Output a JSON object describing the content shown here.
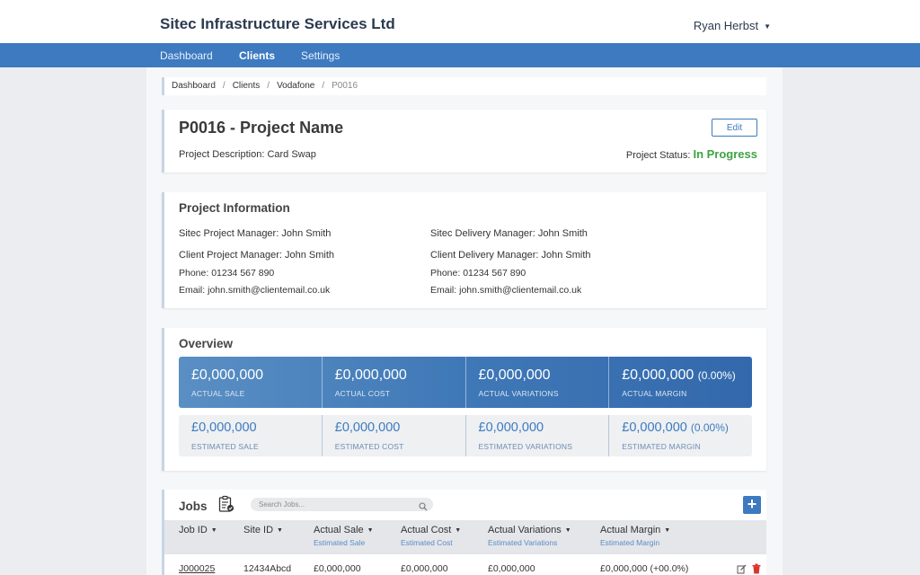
{
  "app": {
    "company_name": "Sitec Infrastructure Services Ltd",
    "user_name": "Ryan Herbst",
    "accent_color": "#3d7abf"
  },
  "nav": {
    "dashboard": "Dashboard",
    "clients": "Clients",
    "settings": "Settings"
  },
  "breadcrumb": [
    "Dashboard",
    "Clients",
    "Vodafone",
    "P0016"
  ],
  "project": {
    "title": "P0016 - Project Name",
    "edit_label": "Edit",
    "description_label": "Project Description:",
    "description_value": "Card Swap",
    "status_label": "Project Status:",
    "status_value": "In Progress",
    "status_color": "#3ea343"
  },
  "info": {
    "heading": "Project Information",
    "sitec_pm_label": "Sitec Project Manager:",
    "sitec_pm_value": "John Smith",
    "sitec_dm_label": "Sitec Delivery Manager:",
    "sitec_dm_value": "John Smith",
    "client_pm_label": "Client Project Manager:",
    "client_pm_value": "John Smith",
    "client_dm_label": "Client Delivery Manager:",
    "client_dm_value": "John Smith",
    "phone_label": "Phone:",
    "phone_left": "01234 567 890",
    "phone_right": "01234 567 890",
    "email_label": "Email:",
    "email_left": "john.smith@clientemail.co.uk",
    "email_right": "john.smith@clientemail.co.uk"
  },
  "overview": {
    "heading": "Overview",
    "actual": [
      {
        "value": "£0,000,000",
        "pct": "",
        "label": "Actual Sale"
      },
      {
        "value": "£0,000,000",
        "pct": "",
        "label": "Actual Cost"
      },
      {
        "value": "£0,000,000",
        "pct": "",
        "label": "Actual Variations"
      },
      {
        "value": "£0,000,000",
        "pct": "(0.00%)",
        "label": "Actual Margin"
      }
    ],
    "estimated": [
      {
        "value": "£0,000,000",
        "pct": "",
        "label": "Estimated Sale"
      },
      {
        "value": "£0,000,000",
        "pct": "",
        "label": "Estimated Cost"
      },
      {
        "value": "£0,000,000",
        "pct": "",
        "label": "Estimated Variations"
      },
      {
        "value": "£0,000,000",
        "pct": "(0.00%)",
        "label": "Estimated Margin"
      }
    ]
  },
  "jobs": {
    "heading": "Jobs",
    "search_placeholder": "Search Jobs...",
    "add_label": "+",
    "columns": [
      {
        "label": "Job ID",
        "sub": ""
      },
      {
        "label": "Site ID",
        "sub": ""
      },
      {
        "label": "Actual Sale",
        "sub": "Estimated Sale"
      },
      {
        "label": "Actual Cost",
        "sub": "Estimated Cost"
      },
      {
        "label": "Actual Variations",
        "sub": "Estimated Variations"
      },
      {
        "label": "Actual Margin",
        "sub": "Estimated Margin"
      }
    ],
    "rows": [
      {
        "job_id": "J000025",
        "site_id": "12434Abcd",
        "sale": "£0,000,000",
        "cost": "£0,000,000",
        "variations": "£0,000,000",
        "margin": "£0,000,000 (+00.0%)"
      }
    ]
  }
}
